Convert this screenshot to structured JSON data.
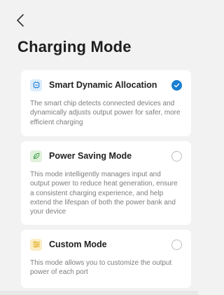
{
  "header": {
    "back_icon": "chevron-left-icon",
    "title": "Charging Mode"
  },
  "modes": [
    {
      "icon": "chip-icon",
      "name": "Smart Dynamic Allocation",
      "description": "The smart chip detects connected devices and dynamically adjusts output power for safer, more efficient charging",
      "selected": true,
      "icon_bg": "#dcecfb",
      "icon_color": "#2f86d6"
    },
    {
      "icon": "leaf-icon",
      "name": "Power Saving Mode",
      "description": "This mode intelligently manages input and output power to reduce heat generation, ensure a consistent charging experience, and help extend the lifespan of both the power bank and your device",
      "selected": false,
      "icon_bg": "#e0f2dc",
      "icon_color": "#3ea04a"
    },
    {
      "icon": "sliders-icon",
      "name": "Custom Mode",
      "description": "This mode allows you to customize the output power of each port",
      "selected": false,
      "icon_bg": "#fbeec5",
      "icon_color": "#e0a81a"
    }
  ],
  "colors": {
    "accent": "#1a7fd1",
    "background": "#f2f2f2",
    "card": "#ffffff"
  }
}
